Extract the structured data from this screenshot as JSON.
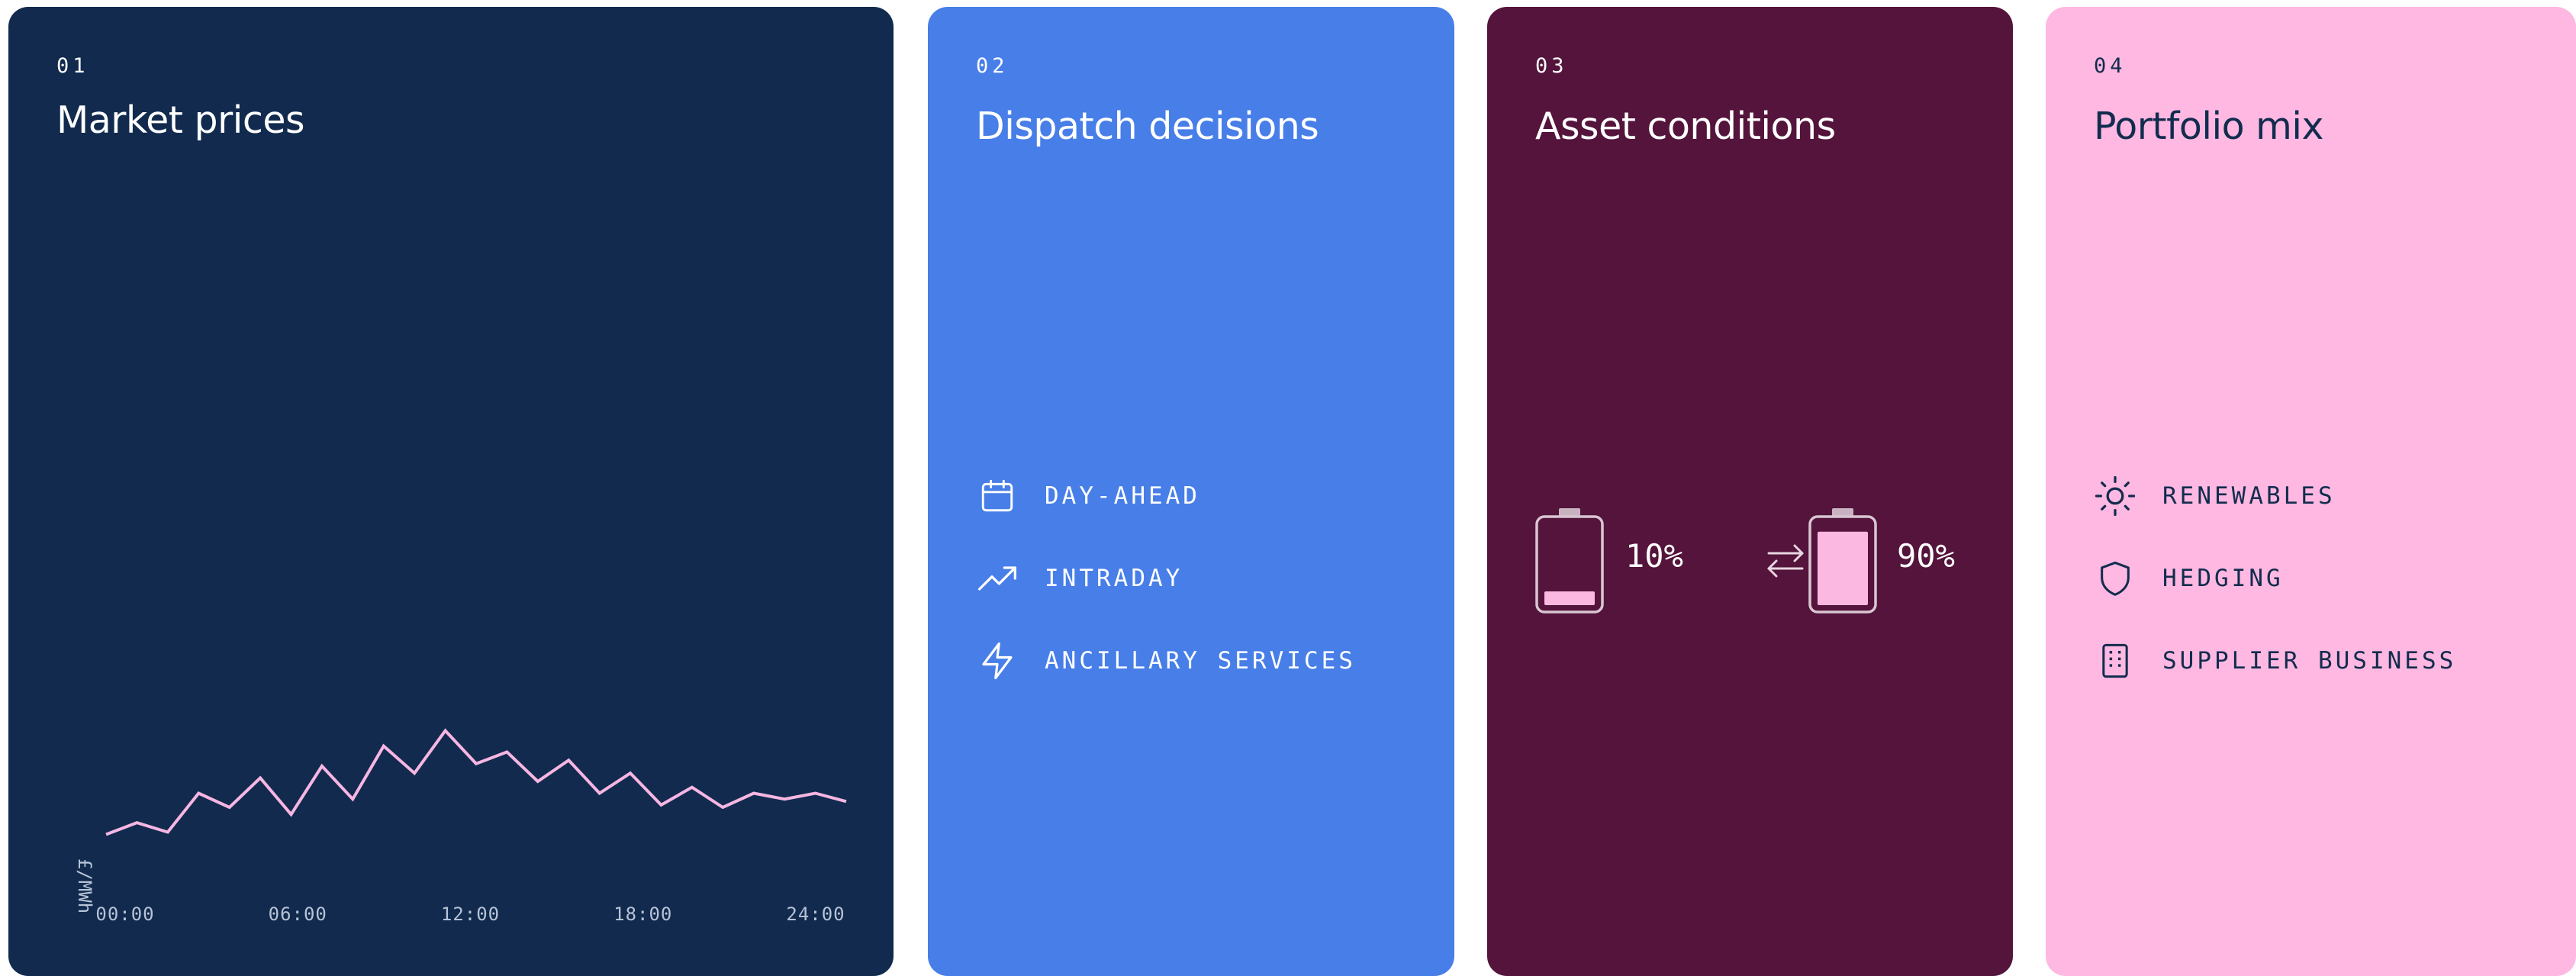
{
  "cards": [
    {
      "number": "01",
      "title": "Market prices",
      "chart_data": {
        "type": "line",
        "x_ticks": [
          "00:00",
          "06:00",
          "12:00",
          "18:00",
          "24:00"
        ],
        "ylabel": "£/MWh",
        "x_hours": [
          0,
          1,
          2,
          3,
          4,
          5,
          6,
          7,
          8,
          9,
          10,
          11,
          12,
          13,
          14,
          15,
          16,
          17,
          18,
          19,
          20,
          21,
          22,
          23,
          24
        ],
        "values": [
          10,
          20,
          12,
          45,
          33,
          58,
          27,
          68,
          40,
          85,
          62,
          98,
          70,
          80,
          55,
          73,
          45,
          62,
          35,
          50,
          33,
          45,
          40,
          45,
          38
        ],
        "ylim": [
          0,
          110
        ],
        "line_color": "#f7b6e2"
      }
    },
    {
      "number": "02",
      "title": "Dispatch decisions",
      "items": [
        {
          "icon": "calendar-icon",
          "label": "DAY-AHEAD"
        },
        {
          "icon": "trending-up-icon",
          "label": "INTRADAY"
        },
        {
          "icon": "lightning-icon",
          "label": "ANCILLARY SERVICES"
        }
      ]
    },
    {
      "number": "03",
      "title": "Asset conditions",
      "batteries": [
        {
          "icon": "battery-low-icon",
          "percent_text": "10%",
          "level": 0.1
        },
        {
          "icon": "battery-high-icon",
          "percent_text": "90%",
          "level": 0.9
        }
      ],
      "swap_icon": "swap-arrows-icon",
      "battery_fill_color": "#fbb8e0"
    },
    {
      "number": "04",
      "title": "Portfolio mix",
      "items": [
        {
          "icon": "sun-icon",
          "label": "RENEWABLES"
        },
        {
          "icon": "shield-icon",
          "label": "HEDGING"
        },
        {
          "icon": "building-icon",
          "label": "SUPPLIER BUSINESS"
        }
      ]
    }
  ],
  "colors": {
    "navy": "#112a4e",
    "blue": "#477ee8",
    "plum": "#54143b",
    "pink": "#feb8e1"
  }
}
